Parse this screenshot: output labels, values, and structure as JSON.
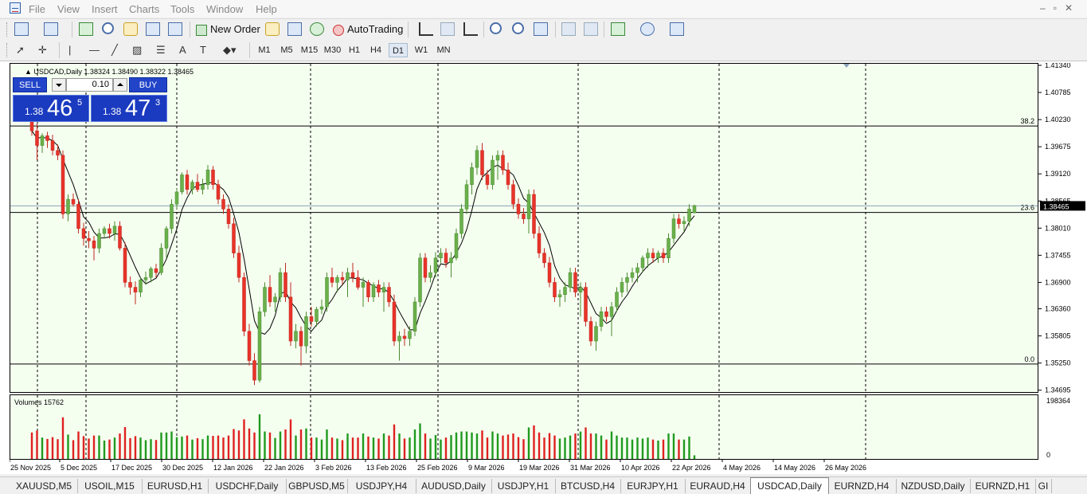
{
  "menu": [
    "File",
    "View",
    "Insert",
    "Charts",
    "Tools",
    "Window",
    "Help"
  ],
  "toolbar": {
    "new_order_label": "New Order",
    "autotrading_label": "AutoTrading",
    "timeframes": [
      "M1",
      "M5",
      "M15",
      "M30",
      "H1",
      "H4",
      "D1",
      "W1",
      "MN"
    ],
    "active_timeframe": "D1",
    "notification_count": "1"
  },
  "chart": {
    "info_line": "USDCAD,Daily  1.38324 1.38490 1.38322 1.38465",
    "volumes_label": "Volumes 15762",
    "current_price_label": "1.38465",
    "price_ticks": [
      "1.41340",
      "1.40785",
      "1.40230",
      "1.39675",
      "1.39120",
      "1.38565",
      "1.38010",
      "1.37455",
      "1.36900",
      "1.36360",
      "1.35805",
      "1.35250",
      "1.34695"
    ],
    "volume_ticks": [
      "198364",
      "0"
    ],
    "fib_labels": [
      "38.2",
      "23.6",
      "0.0"
    ],
    "date_ticks": [
      "25 Nov 2025",
      "5 Dec 2025",
      "17 Dec 2025",
      "30 Dec 2025",
      "12 Jan 2026",
      "22 Jan 2026",
      "3 Feb 2026",
      "13 Feb 2026",
      "25 Feb 2026",
      "9 Mar 2026",
      "19 Mar 2026",
      "31 Mar 2026",
      "10 Apr 2026",
      "22 Apr 2026",
      "4 May 2026",
      "14 May 2026",
      "26 May 2026"
    ]
  },
  "trade_panel": {
    "sell_label": "SELL",
    "buy_label": "BUY",
    "lot": "0.10",
    "sell_prefix": "1.38",
    "sell_big": "46",
    "sell_sup": "5",
    "buy_prefix": "1.38",
    "buy_big": "47",
    "buy_sup": "3"
  },
  "tabs": [
    "XAUUSD,M5",
    "USOIL,M15",
    "EURUSD,H1",
    "USDCHF,Daily",
    "GBPUSD,M5",
    "USDJPY,H4",
    "AUDUSD,Daily",
    "USDJPY,H1",
    "BTCUSD,H4",
    "EURJPY,H1",
    "EURAUD,H4",
    "USDCAD,Daily",
    "EURNZD,H4",
    "NZDUSD,Daily",
    "EURNZD,H1",
    "GI"
  ],
  "active_tab": "USDCAD,Daily",
  "colors": {
    "bull": "#6ab04c",
    "bear": "#e8332a",
    "chart_bg": "#f5fff0",
    "button_blue": "#2144c8"
  },
  "chart_data": {
    "type": "candlestick",
    "title": "USDCAD,Daily",
    "ylim": [
      1.3469,
      1.4134
    ],
    "candles": [
      [
        1.404,
        1.4055,
        1.399,
        1.4
      ],
      [
        1.4,
        1.4015,
        1.394,
        1.397
      ],
      [
        1.397,
        1.3995,
        1.3955,
        1.399
      ],
      [
        1.399,
        1.3998,
        1.3965,
        1.398
      ],
      [
        1.398,
        1.3992,
        1.395,
        1.396
      ],
      [
        1.396,
        1.3972,
        1.394,
        1.395
      ],
      [
        1.395,
        1.396,
        1.382,
        1.383
      ],
      [
        1.383,
        1.387,
        1.3815,
        1.386
      ],
      [
        1.386,
        1.3872,
        1.3845,
        1.385
      ],
      [
        1.385,
        1.386,
        1.379,
        1.38
      ],
      [
        1.38,
        1.3812,
        1.3765,
        1.378
      ],
      [
        1.378,
        1.3795,
        1.376,
        1.3775
      ],
      [
        1.3775,
        1.3785,
        1.3735,
        1.376
      ],
      [
        1.376,
        1.38,
        1.375,
        1.379
      ],
      [
        1.379,
        1.3805,
        1.378,
        1.38
      ],
      [
        1.38,
        1.381,
        1.378,
        1.379
      ],
      [
        1.379,
        1.3815,
        1.3775,
        1.3805
      ],
      [
        1.3805,
        1.3815,
        1.3755,
        1.376
      ],
      [
        1.376,
        1.3772,
        1.368,
        1.369
      ],
      [
        1.369,
        1.3702,
        1.3665,
        1.368
      ],
      [
        1.368,
        1.3692,
        1.3645,
        1.367
      ],
      [
        1.367,
        1.37,
        1.366,
        1.3695
      ],
      [
        1.3695,
        1.3712,
        1.3685,
        1.37
      ],
      [
        1.37,
        1.3722,
        1.369,
        1.3718
      ],
      [
        1.3718,
        1.3728,
        1.37,
        1.371
      ],
      [
        1.371,
        1.377,
        1.3705,
        1.376
      ],
      [
        1.376,
        1.3805,
        1.374,
        1.38
      ],
      [
        1.38,
        1.386,
        1.379,
        1.385
      ],
      [
        1.385,
        1.3882,
        1.384,
        1.3875
      ],
      [
        1.3875,
        1.3915,
        1.387,
        1.391
      ],
      [
        1.391,
        1.392,
        1.387,
        1.388
      ],
      [
        1.388,
        1.39,
        1.387,
        1.3895
      ],
      [
        1.3895,
        1.3912,
        1.3875,
        1.388
      ],
      [
        1.388,
        1.3902,
        1.387,
        1.389
      ],
      [
        1.389,
        1.393,
        1.388,
        1.392
      ],
      [
        1.392,
        1.3928,
        1.388,
        1.389
      ],
      [
        1.389,
        1.39,
        1.385,
        1.386
      ],
      [
        1.386,
        1.387,
        1.383,
        1.384
      ],
      [
        1.384,
        1.385,
        1.38,
        1.381
      ],
      [
        1.381,
        1.3822,
        1.374,
        1.375
      ],
      [
        1.375,
        1.3765,
        1.369,
        1.37
      ],
      [
        1.37,
        1.371,
        1.358,
        1.359
      ],
      [
        1.359,
        1.3605,
        1.352,
        1.353
      ],
      [
        1.353,
        1.3545,
        1.348,
        1.349
      ],
      [
        1.349,
        1.364,
        1.3485,
        1.363
      ],
      [
        1.363,
        1.369,
        1.362,
        1.368
      ],
      [
        1.368,
        1.3705,
        1.364,
        1.365
      ],
      [
        1.365,
        1.3668,
        1.363,
        1.366
      ],
      [
        1.366,
        1.372,
        1.365,
        1.371
      ],
      [
        1.371,
        1.373,
        1.365,
        1.366
      ],
      [
        1.366,
        1.369,
        1.356,
        1.357
      ],
      [
        1.357,
        1.3605,
        1.3555,
        1.359
      ],
      [
        1.359,
        1.36,
        1.352,
        1.356
      ],
      [
        1.356,
        1.363,
        1.3545,
        1.362
      ],
      [
        1.362,
        1.364,
        1.36,
        1.361
      ],
      [
        1.361,
        1.364,
        1.36,
        1.3635
      ],
      [
        1.3635,
        1.3655,
        1.3625,
        1.364
      ],
      [
        1.364,
        1.371,
        1.363,
        1.37
      ],
      [
        1.37,
        1.372,
        1.368,
        1.369
      ],
      [
        1.369,
        1.3705,
        1.367,
        1.37
      ],
      [
        1.37,
        1.3712,
        1.3685,
        1.3695
      ],
      [
        1.3695,
        1.372,
        1.366,
        1.371
      ],
      [
        1.371,
        1.373,
        1.369,
        1.37
      ],
      [
        1.37,
        1.3715,
        1.3675,
        1.368
      ],
      [
        1.368,
        1.37,
        1.364,
        1.369
      ],
      [
        1.369,
        1.3695,
        1.365,
        1.366
      ],
      [
        1.366,
        1.369,
        1.365,
        1.3685
      ],
      [
        1.3685,
        1.3695,
        1.366,
        1.367
      ],
      [
        1.367,
        1.369,
        1.363,
        1.368
      ],
      [
        1.368,
        1.369,
        1.364,
        1.365
      ],
      [
        1.365,
        1.3665,
        1.356,
        1.357
      ],
      [
        1.357,
        1.359,
        1.353,
        1.358
      ],
      [
        1.358,
        1.3595,
        1.356,
        1.3575
      ],
      [
        1.3575,
        1.36,
        1.356,
        1.359
      ],
      [
        1.359,
        1.366,
        1.358,
        1.365
      ],
      [
        1.365,
        1.375,
        1.364,
        1.374
      ],
      [
        1.374,
        1.375,
        1.369,
        1.37
      ],
      [
        1.37,
        1.3725,
        1.369,
        1.371
      ],
      [
        1.371,
        1.3752,
        1.37,
        1.374
      ],
      [
        1.374,
        1.376,
        1.373,
        1.375
      ],
      [
        1.375,
        1.376,
        1.372,
        1.373
      ],
      [
        1.373,
        1.3752,
        1.37,
        1.374
      ],
      [
        1.374,
        1.38,
        1.3735,
        1.379
      ],
      [
        1.379,
        1.385,
        1.378,
        1.384
      ],
      [
        1.384,
        1.39,
        1.383,
        1.389
      ],
      [
        1.389,
        1.3935,
        1.387,
        1.3925
      ],
      [
        1.3925,
        1.397,
        1.391,
        1.396
      ],
      [
        1.396,
        1.3975,
        1.39,
        1.391
      ],
      [
        1.391,
        1.392,
        1.388,
        1.389
      ],
      [
        1.389,
        1.395,
        1.388,
        1.394
      ],
      [
        1.394,
        1.396,
        1.39,
        1.395
      ],
      [
        1.395,
        1.396,
        1.391,
        1.392
      ],
      [
        1.392,
        1.3935,
        1.388,
        1.389
      ],
      [
        1.389,
        1.39,
        1.384,
        1.385
      ],
      [
        1.385,
        1.3862,
        1.382,
        1.383
      ],
      [
        1.383,
        1.3842,
        1.381,
        1.382
      ],
      [
        1.382,
        1.388,
        1.379,
        1.387
      ],
      [
        1.387,
        1.388,
        1.378,
        1.379
      ],
      [
        1.379,
        1.3805,
        1.374,
        1.375
      ],
      [
        1.375,
        1.376,
        1.372,
        1.373
      ],
      [
        1.373,
        1.3742,
        1.368,
        1.369
      ],
      [
        1.369,
        1.37,
        1.365,
        1.366
      ],
      [
        1.366,
        1.3675,
        1.364,
        1.3665
      ],
      [
        1.3665,
        1.369,
        1.365,
        1.368
      ],
      [
        1.368,
        1.372,
        1.367,
        1.371
      ],
      [
        1.371,
        1.372,
        1.366,
        1.367
      ],
      [
        1.367,
        1.369,
        1.362,
        1.368
      ],
      [
        1.368,
        1.369,
        1.36,
        1.361
      ],
      [
        1.361,
        1.362,
        1.356,
        1.357
      ],
      [
        1.357,
        1.361,
        1.355,
        1.36
      ],
      [
        1.36,
        1.364,
        1.359,
        1.363
      ],
      [
        1.363,
        1.364,
        1.361,
        1.362
      ],
      [
        1.362,
        1.365,
        1.358,
        1.364
      ],
      [
        1.364,
        1.368,
        1.363,
        1.367
      ],
      [
        1.367,
        1.37,
        1.366,
        1.369
      ],
      [
        1.369,
        1.371,
        1.367,
        1.37
      ],
      [
        1.37,
        1.372,
        1.369,
        1.371
      ],
      [
        1.371,
        1.373,
        1.369,
        1.372
      ],
      [
        1.372,
        1.3745,
        1.371,
        1.374
      ],
      [
        1.374,
        1.376,
        1.372,
        1.375
      ],
      [
        1.375,
        1.376,
        1.373,
        1.374
      ],
      [
        1.374,
        1.3755,
        1.373,
        1.375
      ],
      [
        1.375,
        1.376,
        1.373,
        1.374
      ],
      [
        1.374,
        1.379,
        1.373,
        1.378
      ],
      [
        1.378,
        1.383,
        1.377,
        1.382
      ],
      [
        1.382,
        1.383,
        1.38,
        1.381
      ],
      [
        1.381,
        1.3825,
        1.3795,
        1.3815
      ],
      [
        1.3815,
        1.385,
        1.3805,
        1.384
      ],
      [
        1.3832,
        1.3849,
        1.3832,
        1.3847
      ]
    ],
    "ma_label": "",
    "fib_levels": [
      {
        "label": "38.2",
        "price": 1.401
      },
      {
        "label": "23.6",
        "price": 1.3833
      },
      {
        "label": "0.0",
        "price": 1.3523
      }
    ],
    "current_price": 1.38465,
    "volume_max": 198364
  }
}
